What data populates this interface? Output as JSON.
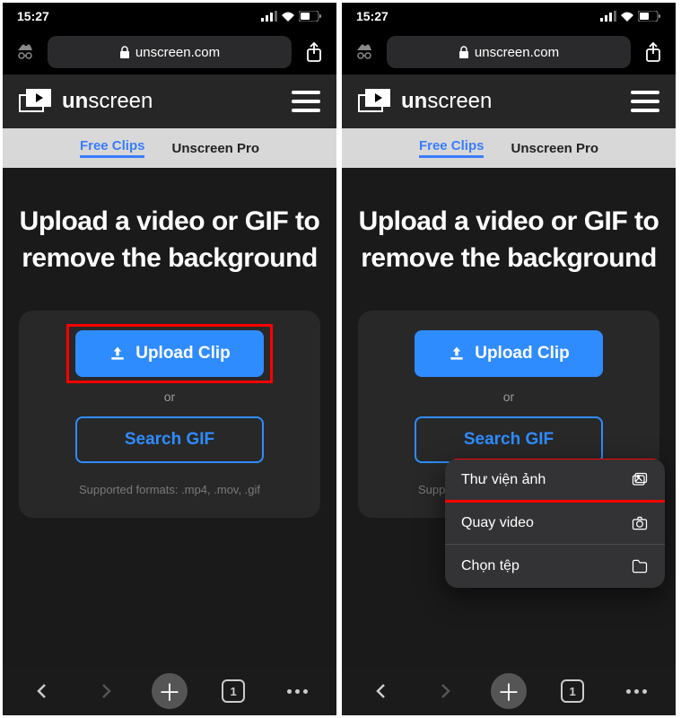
{
  "status": {
    "time": "15:27"
  },
  "urlbar": {
    "domain": "unscreen.com"
  },
  "header": {
    "brand_prefix": "un",
    "brand_rest": "screen"
  },
  "tabs": {
    "free": "Free Clips",
    "pro": "Unscreen Pro"
  },
  "main": {
    "headline": "Upload a video or GIF to remove the background",
    "upload_label": "Upload Clip",
    "or_label": "or",
    "search_label": "Search GIF",
    "supported": "Supported formats: .mp4, .mov, .gif"
  },
  "popup": {
    "items": [
      {
        "label": "Thư viện ảnh",
        "icon": "gallery"
      },
      {
        "label": "Quay video",
        "icon": "camera"
      },
      {
        "label": "Chọn tệp",
        "icon": "folder"
      }
    ]
  },
  "bottomnav": {
    "tab_count": "1"
  }
}
